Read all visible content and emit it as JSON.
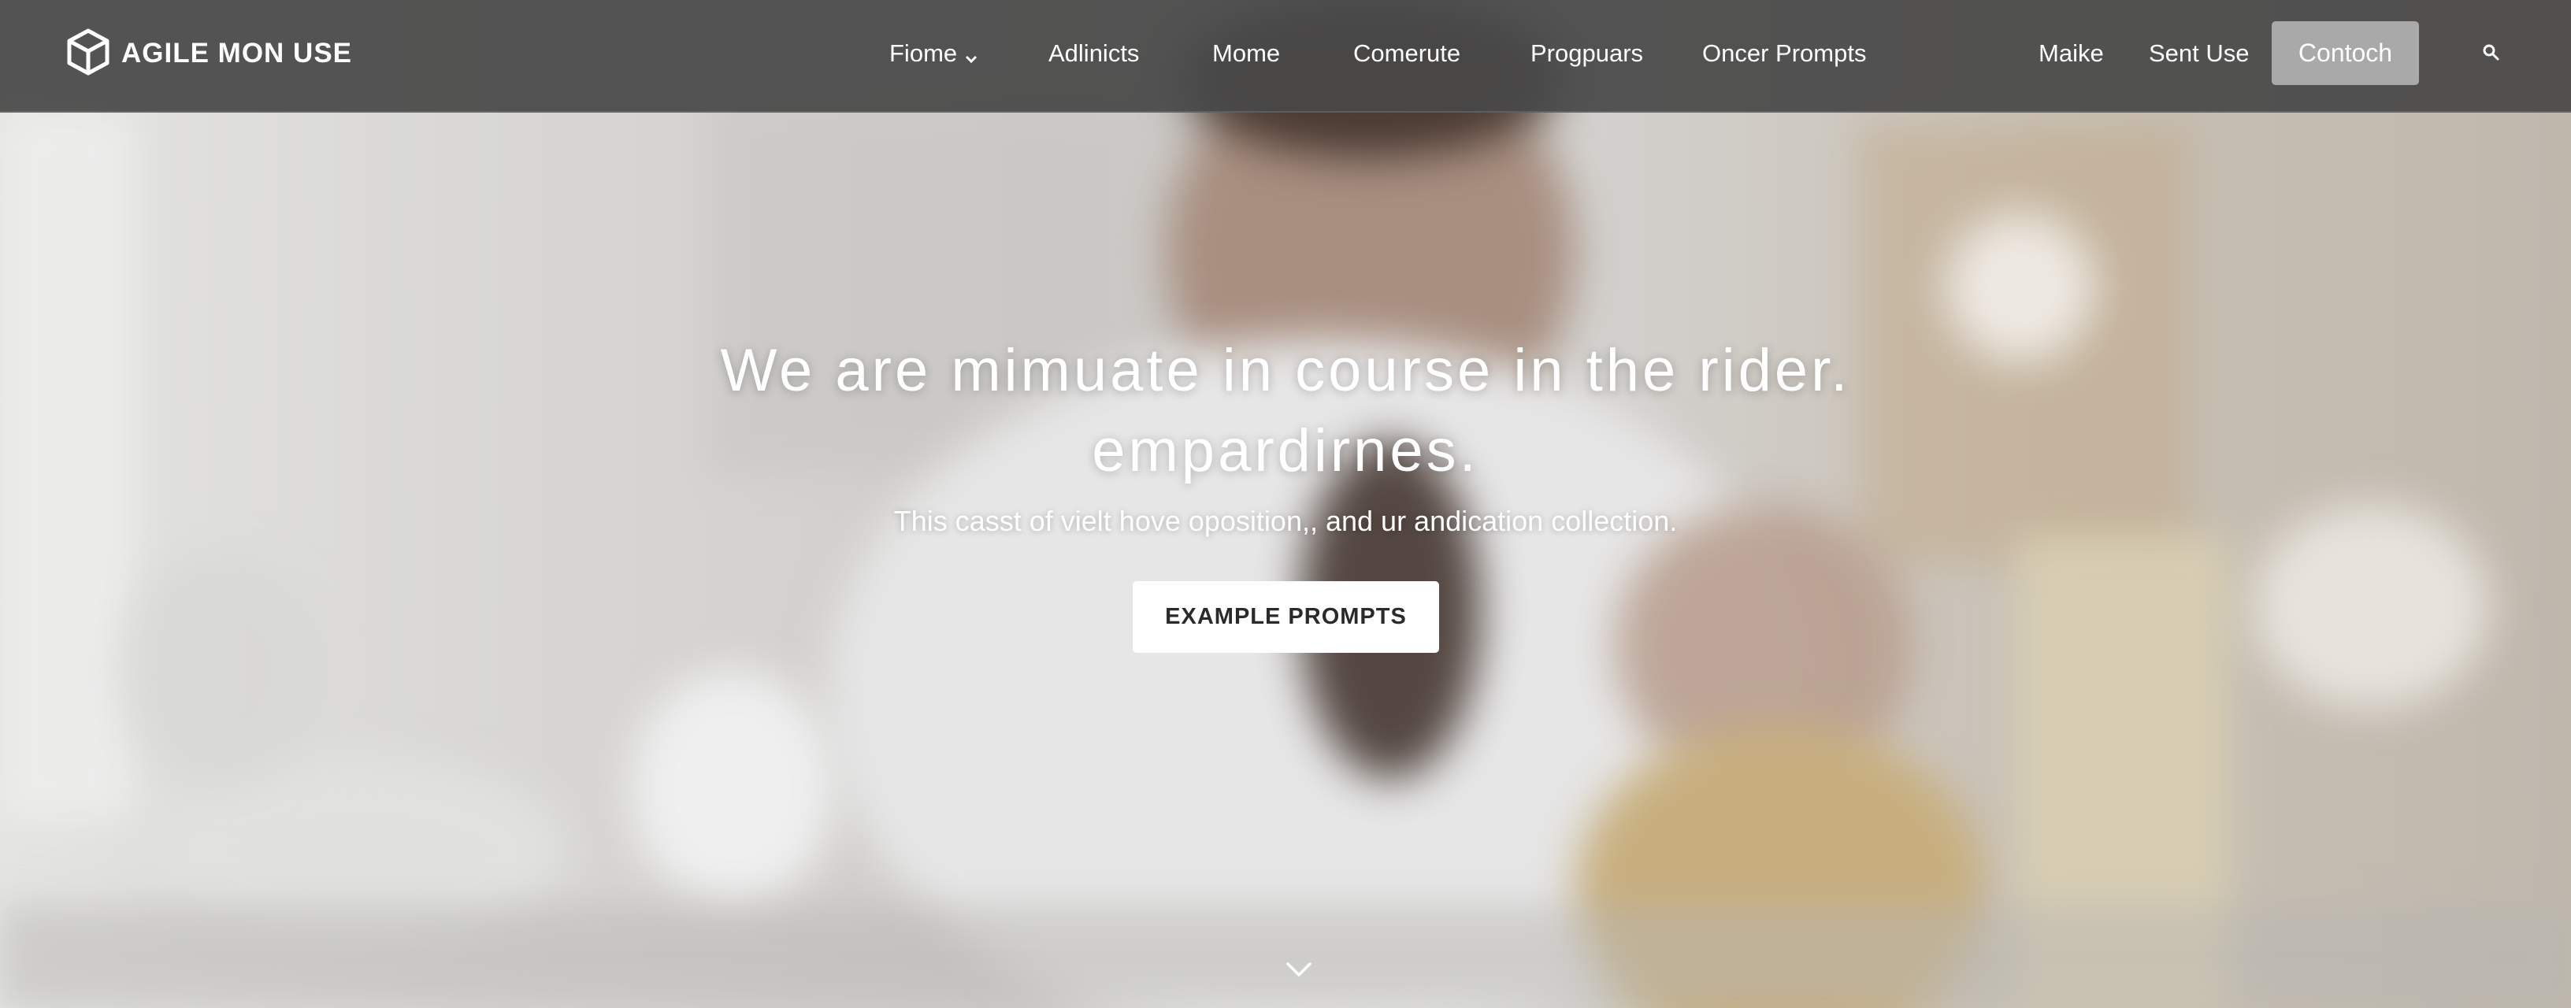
{
  "brand": {
    "name": "AGILE MON USE",
    "icon": "cube-icon"
  },
  "nav": {
    "items": [
      {
        "label": "Fiome",
        "has_dropdown": true
      },
      {
        "label": "Adlinicts"
      },
      {
        "label": "Mome"
      },
      {
        "label": "Comerute"
      },
      {
        "label": "Progpuars"
      },
      {
        "label": "Oncer Prompts"
      }
    ],
    "right": [
      {
        "label": "Maike"
      },
      {
        "label": "Sent Use"
      }
    ],
    "contact_label": "Contoch",
    "search_icon": "search-icon"
  },
  "hero": {
    "headline_line1": "We are mimuate in course in the rider.",
    "headline_line2": "empardirnes.",
    "subheadline": "This casst of vielt hove oposition,, and ur andication collection.",
    "cta_label": "EXAMPLE PROMPTS",
    "scroll_icon": "chevron-down-icon"
  },
  "colors": {
    "navbar_bg": "#484848",
    "contact_bg": "#a9a9a9",
    "cta_bg": "#ffffff",
    "text": "#ffffff"
  }
}
